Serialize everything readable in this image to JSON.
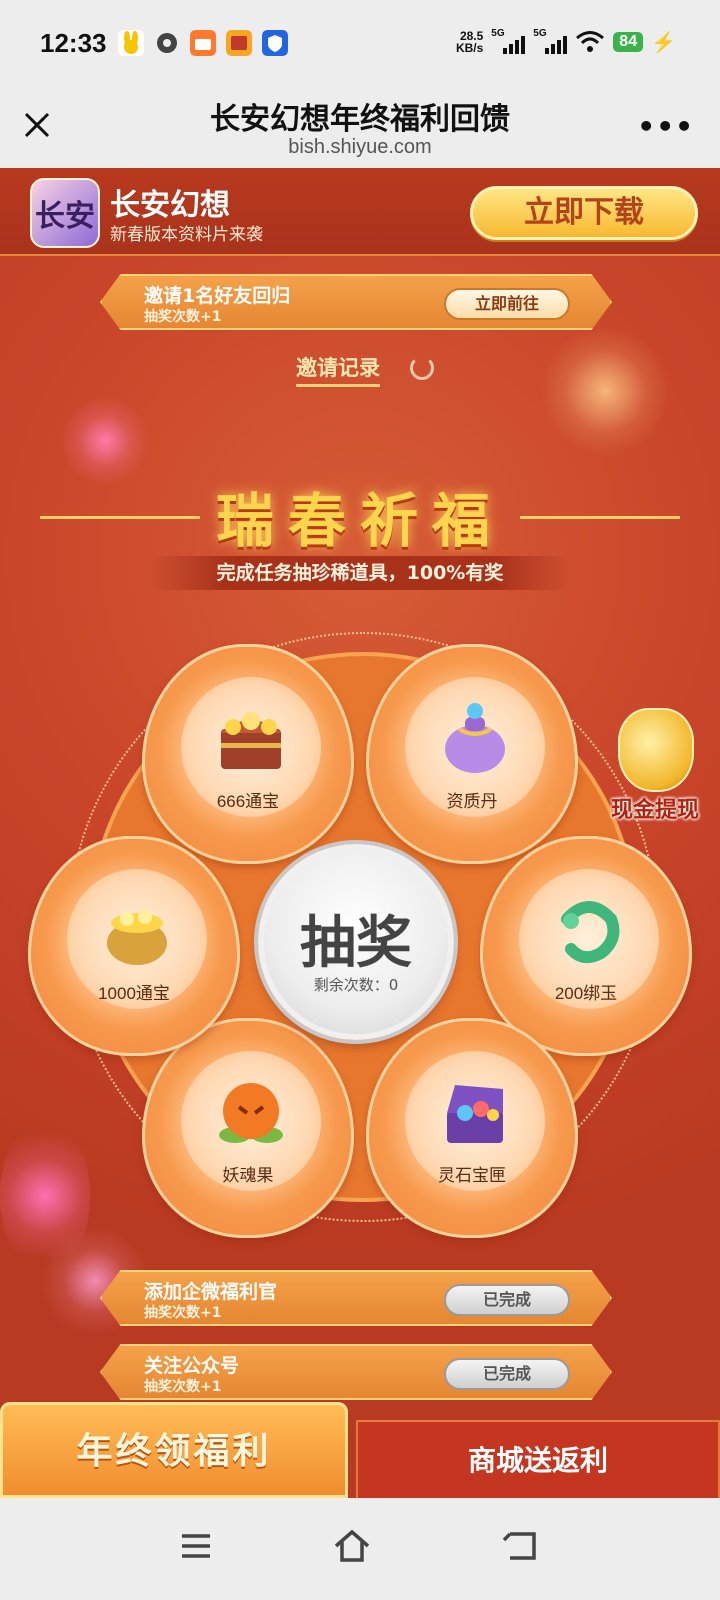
{
  "status_bar": {
    "time": "12:33",
    "net_speed_value": "28.5",
    "net_speed_unit": "KB/s",
    "signal_1": "5G",
    "signal_2": "5G",
    "battery": "84"
  },
  "title_bar": {
    "title": "长安幻想年终福利回馈",
    "url": "bish.shiyue.com",
    "more_label": "•••"
  },
  "banner": {
    "app_icon_text": "长安",
    "app_name": "长安幻想",
    "slogan": "新春版本资料片来袭",
    "download_label": "立即下载"
  },
  "invite_task": {
    "title": "邀请1名好友回归",
    "reward": "抽奖次数+1",
    "button": "立即前往"
  },
  "invite_record": "邀请记录",
  "heading": "瑞春祈福",
  "sub_heading": "完成任务抽珍稀道具，100%有奖",
  "wheel": {
    "prizes": [
      {
        "label": "666通宝",
        "icon": "treasure-chest-icon"
      },
      {
        "label": "资质丹",
        "icon": "purple-pouch-icon"
      },
      {
        "label": "200绑玉",
        "icon": "jade-dragon-icon"
      },
      {
        "label": "灵石宝匣",
        "icon": "gem-chest-icon"
      },
      {
        "label": "妖魂果",
        "icon": "spirit-fruit-icon"
      },
      {
        "label": "1000通宝",
        "icon": "gold-pot-icon"
      }
    ],
    "draw_label": "抽奖",
    "remaining_text": "剩余次数：0"
  },
  "cash_widget": "现金提现",
  "tasks": [
    {
      "title": "添加企微福利官",
      "reward": "抽奖次数+1",
      "button": "已完成"
    },
    {
      "title": "关注公众号",
      "reward": "抽奖次数+1",
      "button": "已完成"
    }
  ],
  "tabs": {
    "left": "年终领福利",
    "right": "商城送返利"
  },
  "colors": {
    "background": "#c9452a",
    "accent_gold": "#ffd54d",
    "petal": "#f79a4e"
  }
}
